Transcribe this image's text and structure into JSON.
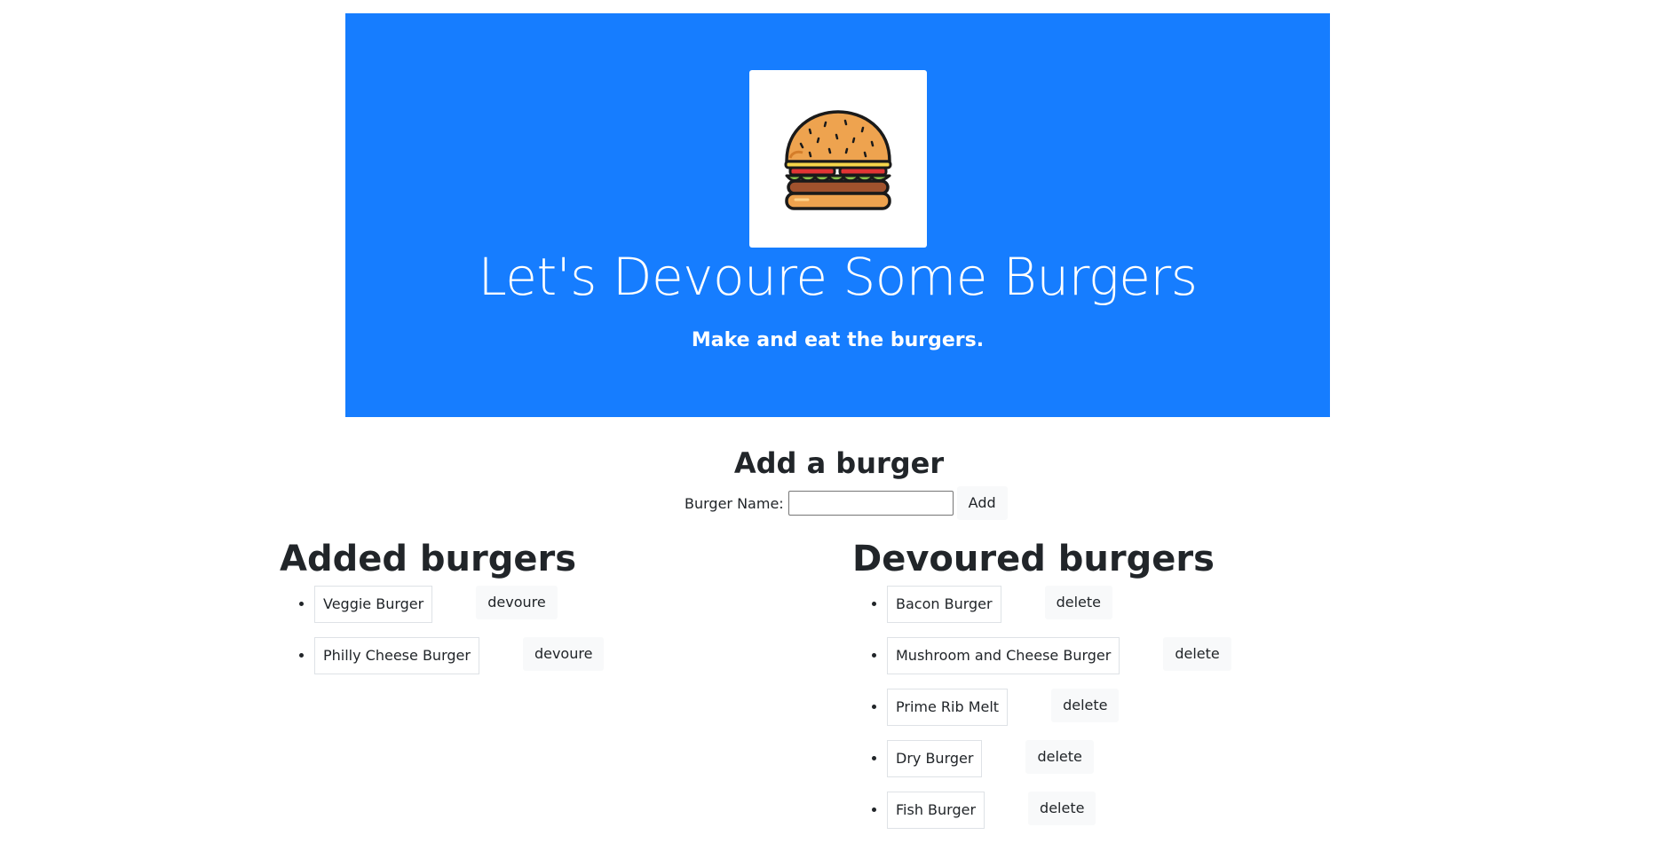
{
  "header": {
    "logo_icon": "burger-icon",
    "title": "Let's Devoure Some Burgers",
    "subtitle": "Make and eat the burgers.",
    "background_color": "#167dff"
  },
  "add_form": {
    "heading": "Add a burger",
    "label": "Burger Name:",
    "input_value": "",
    "button_label": "Add"
  },
  "added": {
    "heading": "Added burgers",
    "items": [
      {
        "name": "Veggie Burger",
        "action": "devoure"
      },
      {
        "name": "Philly Cheese Burger",
        "action": "devoure"
      }
    ]
  },
  "devoured": {
    "heading": "Devoured burgers",
    "items": [
      {
        "name": "Bacon Burger",
        "action": "delete"
      },
      {
        "name": "Mushroom and Cheese Burger",
        "action": "delete"
      },
      {
        "name": "Prime Rib Melt",
        "action": "delete"
      },
      {
        "name": "Dry Burger",
        "action": "delete"
      },
      {
        "name": "Fish Burger",
        "action": "delete"
      }
    ]
  }
}
